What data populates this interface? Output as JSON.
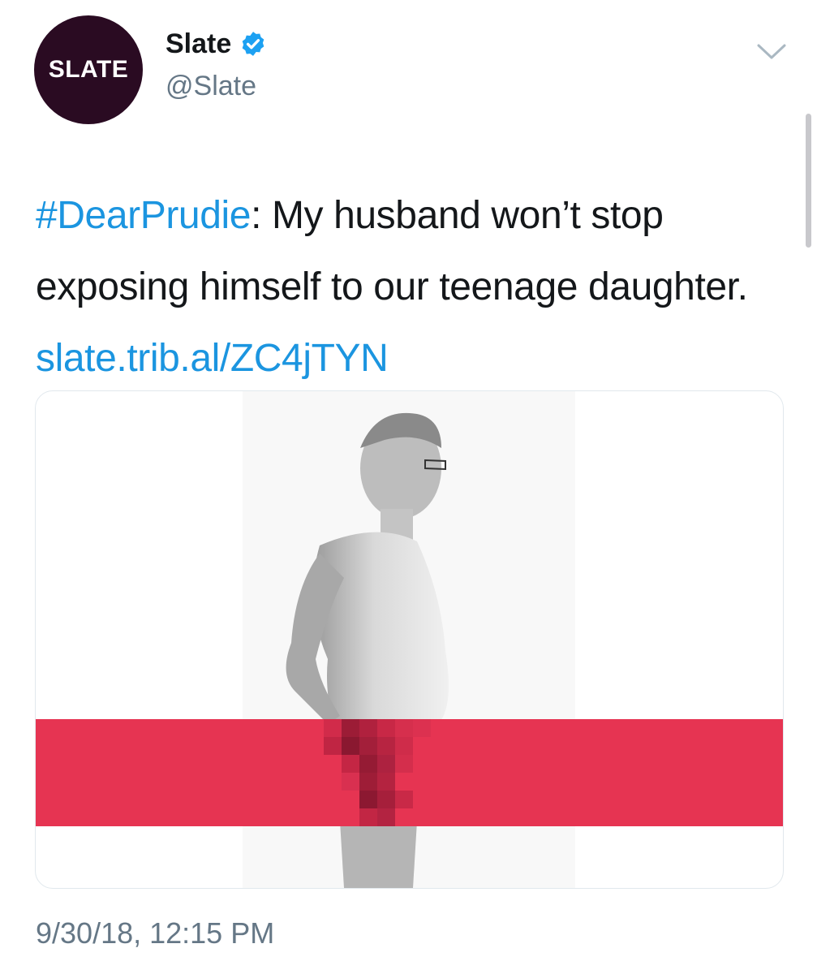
{
  "tweet": {
    "avatar_text": "SLATE",
    "display_name": "Slate",
    "handle": "@Slate",
    "hashtag": "#DearPrudie",
    "text": ": My husband won’t stop exposing himself to our teenage daughter. ",
    "link": "slate.trib.al/ZC4jTYN",
    "timestamp": "9/30/18, 12:15 PM"
  },
  "icons": {
    "verified": "verified-badge-icon",
    "menu": "chevron-down-icon"
  },
  "colors": {
    "link": "#1b95e0",
    "avatar_bg": "#2a0b22",
    "verified": "#1da1f2",
    "banner": "#e63452"
  }
}
